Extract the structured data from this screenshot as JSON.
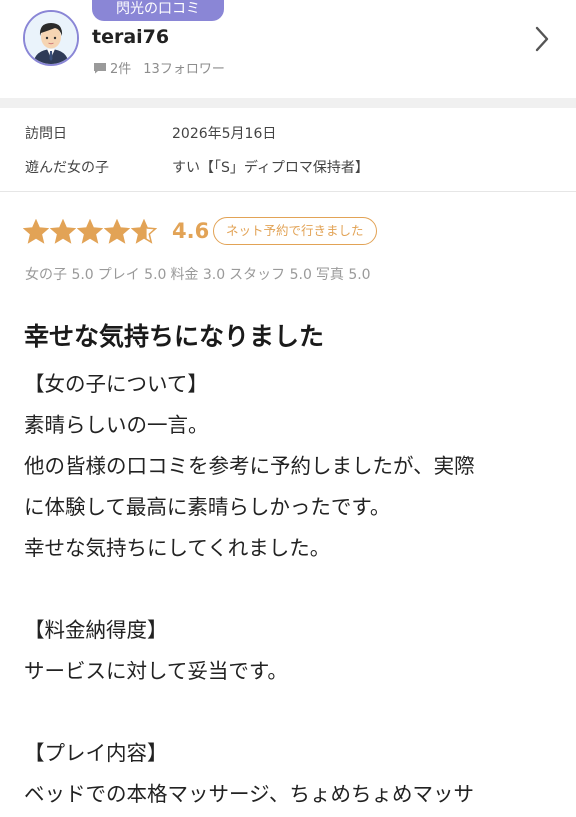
{
  "header": {
    "category_badge": "閃光の口コミ",
    "username": "terai76",
    "review_count": "2件",
    "followers": "13フォロワー"
  },
  "info": {
    "visit_label": "訪問日",
    "visit_value": "2026年5月16日",
    "girl_label": "遊んだ女の子",
    "girl_value": "すい【「S」ディプロマ保持者】"
  },
  "rating": {
    "stars": 4.6,
    "score": "4.6",
    "booking_badge": "ネット予約で行きました",
    "sub_scores": [
      {
        "text": "女の子 5.0"
      },
      {
        "text": "プレイ 5.0"
      },
      {
        "text": "料金 3.0"
      },
      {
        "text": "スタッフ 5.0"
      },
      {
        "text": "写真 5.0"
      }
    ],
    "star_color": "#e2a356"
  },
  "review": {
    "title": "幸せな気持ちになりました",
    "lines": [
      "【女の子について】",
      "素晴らしいの一言。",
      "他の皆様の口コミを参考に予約しましたが、実際",
      "に体験して最高に素晴らしかったです。",
      "幸せな気持ちにしてくれました。",
      "",
      "【料金納得度】",
      "サービスに対して妥当です。",
      "",
      "【プレイ内容】",
      "ベッドでの本格マッサージ、ちょめちょめマッサ"
    ]
  }
}
